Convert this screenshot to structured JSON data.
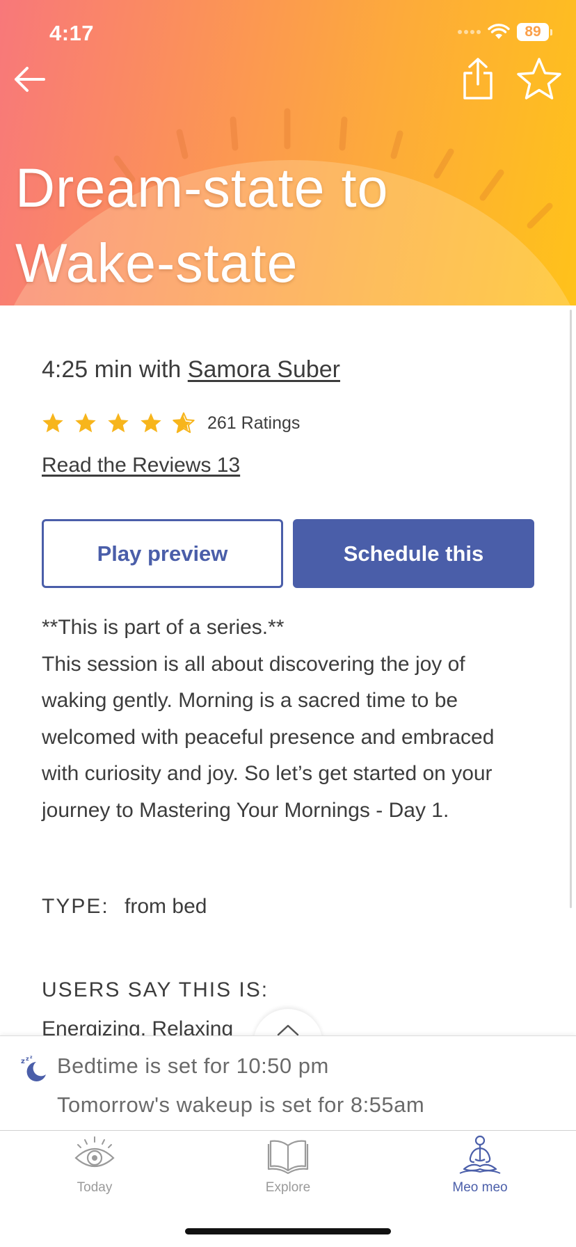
{
  "status_bar": {
    "time": "4:17",
    "battery": "89"
  },
  "hero": {
    "title_line1": "Dream-state to",
    "title_line2": "Wake-state"
  },
  "session": {
    "duration_prefix": "4:25 min with",
    "teacher": "Samora Suber",
    "rating_stars": 4.5,
    "ratings_count": "261 Ratings",
    "reviews_link": "Read the Reviews 13"
  },
  "actions": {
    "preview_label": "Play preview",
    "schedule_label": "Schedule this"
  },
  "description": {
    "series_note": "**This is part of a series.**",
    "body": "This session is all about discovering the joy of waking gently. Morning is a sacred time to be welcomed with peaceful presence and embraced with curiosity and joy. So let’s get started on your journey to Mastering Your Mornings - Day 1."
  },
  "details": {
    "type_label": "TYPE:",
    "type_value": "from bed",
    "users_say_label": "USERS SAY THIS IS:",
    "users_say_tags": "Energizing, Relaxing"
  },
  "sleep_panel": {
    "bedtime": "Bedtime is set for 10:50 pm",
    "wakeup": "Tomorrow's wakeup is set for 8:55am"
  },
  "tabbar": {
    "tabs": [
      {
        "label": "Today",
        "icon": "eye-icon",
        "active": false
      },
      {
        "label": "Explore",
        "icon": "book-icon",
        "active": false
      },
      {
        "label": "Meo meo",
        "icon": "meditation-icon",
        "active": true
      }
    ]
  },
  "colors": {
    "accent": "#4a5ea9",
    "star": "#f7b51c",
    "hero_gradient_start": "#f8787a",
    "hero_gradient_end": "#ffc21a"
  }
}
